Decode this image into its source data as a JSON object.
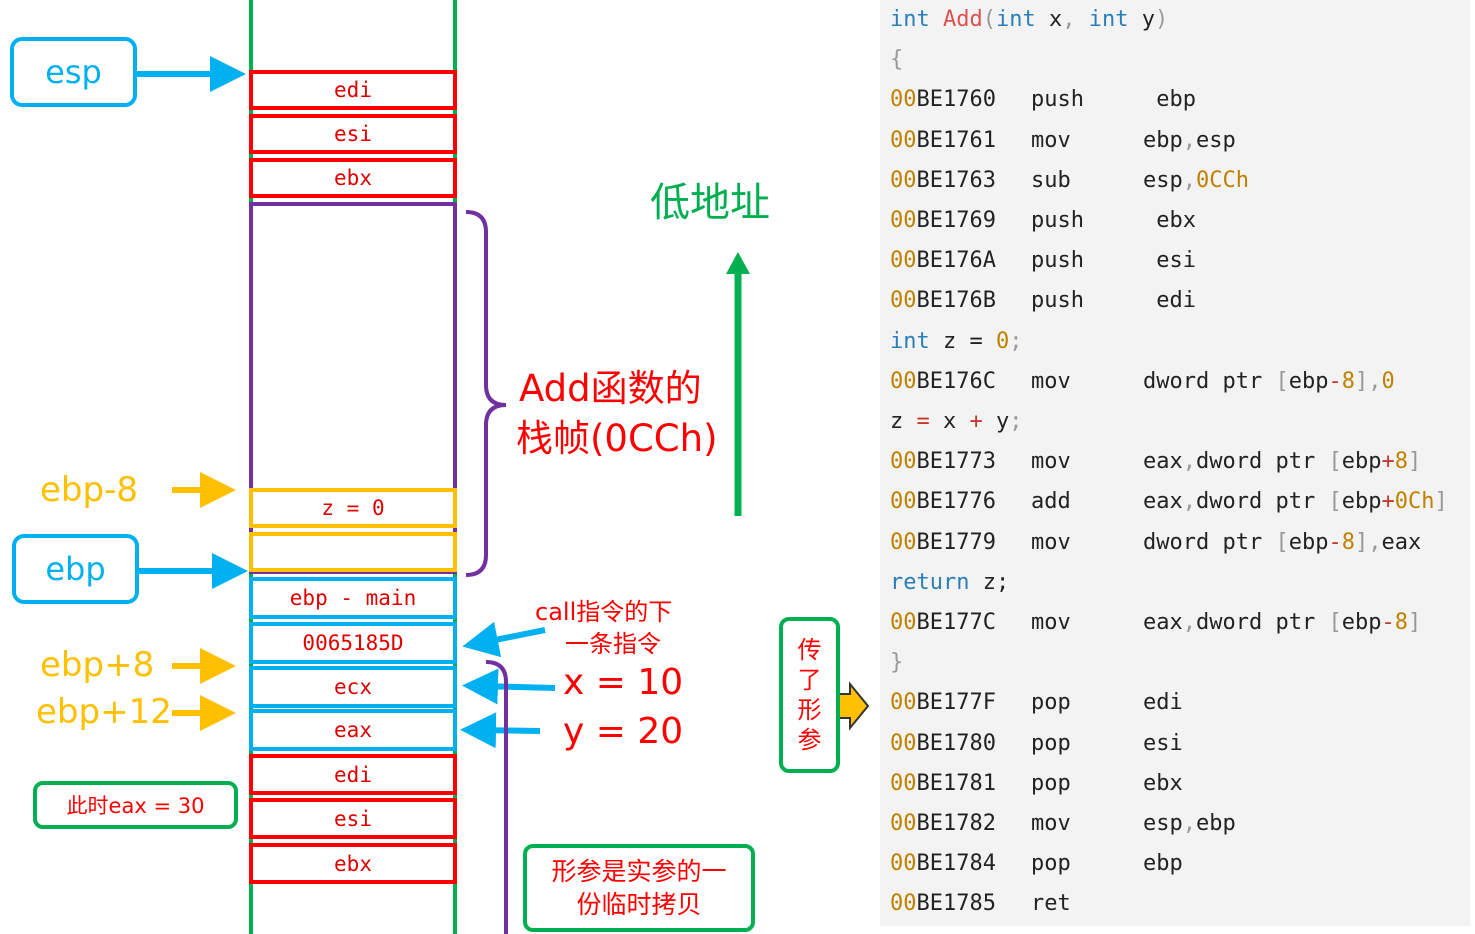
{
  "stack": {
    "esp_label": "esp",
    "ebp_label": "ebp",
    "cells": {
      "edi_top": "edi",
      "esi_top": "esi",
      "ebx_top": "ebx",
      "z": "z = 0",
      "ebp_main": "ebp - main",
      "return_addr": "0065185D",
      "ecx": "ecx",
      "eax": "eax",
      "edi_bottom": "edi",
      "esi_bottom": "esi",
      "ebx_bottom": "ebx"
    },
    "offsets": {
      "ebp_minus_8": "ebp-8",
      "ebp_plus_8": "ebp+8",
      "ebp_plus_12": "ebp+12"
    }
  },
  "annotations": {
    "low_address": "低地址",
    "frame_line1": "Add函数的",
    "frame_line2": "栈帧(0CCh)",
    "call_note_line1": "call指令的下",
    "call_note_line2": "一条指令",
    "x_value": "x  =  10",
    "y_value": "y  =  20",
    "eax_note": "此时eax = 30",
    "param_passed": [
      "传",
      "了",
      "形",
      "参"
    ],
    "copy_note_line1": "形参是实参的一",
    "copy_note_line2": "份临时拷贝"
  },
  "code": {
    "header": {
      "kw1": "int",
      "fn": "Add",
      "open": "(",
      "kw2": "int",
      "p1": " x",
      "comma": ", ",
      "kw3": "int",
      "p2": " y",
      "close": ")"
    },
    "open_brace": "{",
    "close_brace": "}",
    "prologue": [
      {
        "addr_zero": "00",
        "addr": "BE1760",
        "mn": "push",
        "ops": " ebp"
      },
      {
        "addr_zero": "00",
        "addr": "BE1761",
        "mn": "mov",
        "ops": "ebp,esp"
      },
      {
        "addr_zero": "00",
        "addr": "BE1763",
        "mn": "sub",
        "ops": "esp,0CCh"
      },
      {
        "addr_zero": "00",
        "addr": "BE1769",
        "mn": "push",
        "ops": " ebx"
      },
      {
        "addr_zero": "00",
        "addr": "BE176A",
        "mn": "push",
        "ops": " esi"
      },
      {
        "addr_zero": "00",
        "addr": "BE176B",
        "mn": "push",
        "ops": " edi"
      }
    ],
    "src_z_decl": {
      "kw": "int",
      "rest": " z = ",
      "num": "0",
      "end": ";"
    },
    "asm_z_decl": {
      "addr_zero": "00",
      "addr": "BE176C",
      "mn": "mov",
      "ops": "dword ptr [ebp-8],0"
    },
    "src_z_sum": "z = x + y;",
    "sum_block": [
      {
        "addr_zero": "00",
        "addr": "BE1773",
        "mn": "mov",
        "ops": "eax,dword ptr [ebp+8]"
      },
      {
        "addr_zero": "00",
        "addr": "BE1776",
        "mn": "add",
        "ops": "eax,dword ptr [ebp+0Ch]"
      },
      {
        "addr_zero": "00",
        "addr": "BE1779",
        "mn": "mov",
        "ops": "dword ptr [ebp-8],eax"
      }
    ],
    "src_return": {
      "kw": "return",
      "rest": " z;"
    },
    "asm_return": {
      "addr_zero": "00",
      "addr": "BE177C",
      "mn": "mov",
      "ops": "eax,dword ptr [ebp-8]"
    },
    "epilogue": [
      {
        "addr_zero": "00",
        "addr": "BE177F",
        "mn": "pop",
        "ops": "edi"
      },
      {
        "addr_zero": "00",
        "addr": "BE1780",
        "mn": "pop",
        "ops": "esi"
      },
      {
        "addr_zero": "00",
        "addr": "BE1781",
        "mn": "pop",
        "ops": "ebx"
      },
      {
        "addr_zero": "00",
        "addr": "BE1782",
        "mn": "mov",
        "ops": "esp,ebp"
      },
      {
        "addr_zero": "00",
        "addr": "BE1784",
        "mn": "pop",
        "ops": "ebp"
      },
      {
        "addr_zero": "00",
        "addr": "BE1785",
        "mn": "ret",
        "ops": ""
      }
    ]
  },
  "colors": {
    "green": "#00b050",
    "red": "#ff0000",
    "blue": "#00b0f0",
    "orange": "#ffc000",
    "purple": "#7030a0"
  }
}
